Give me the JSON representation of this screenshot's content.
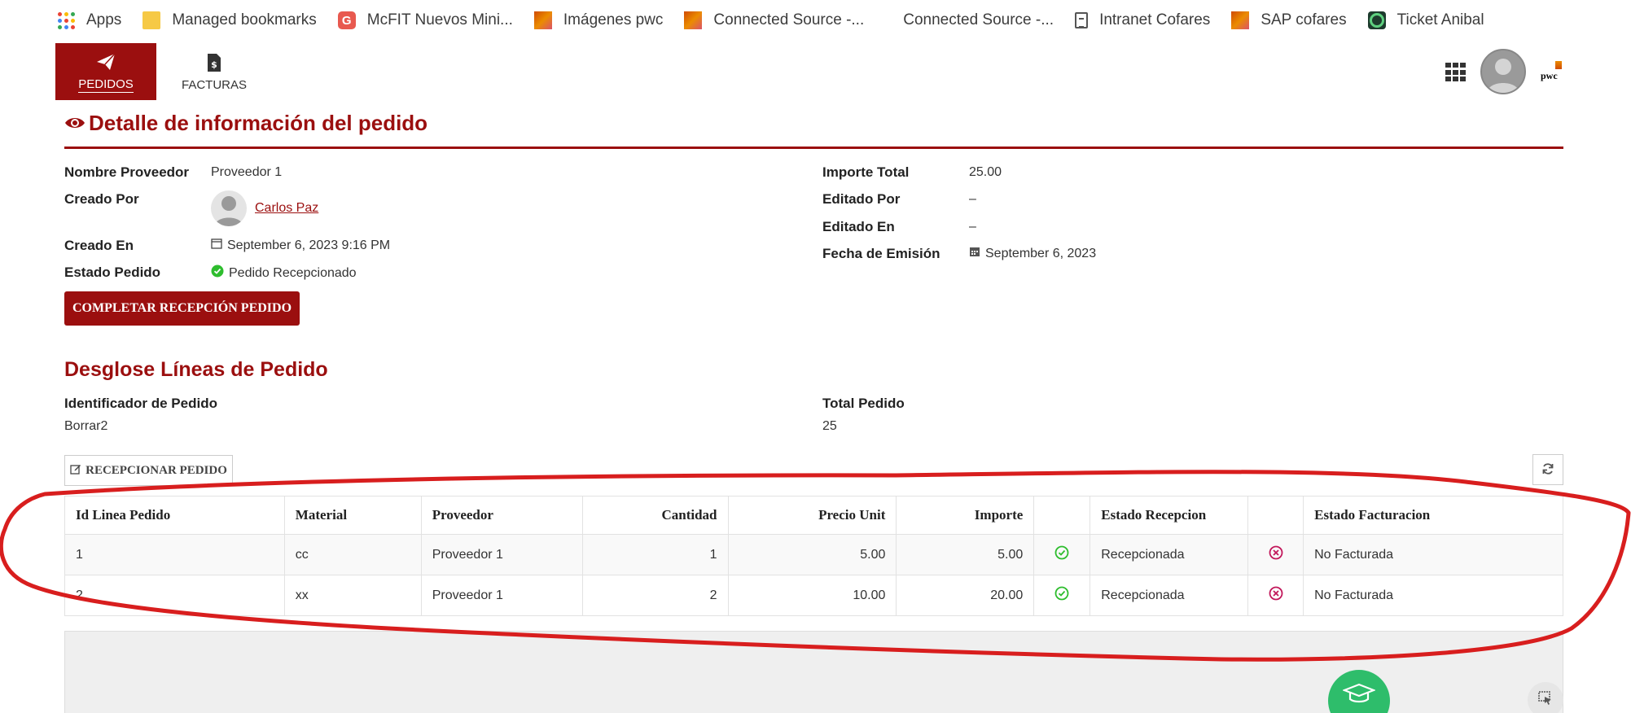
{
  "bookmarks": [
    {
      "label": "Apps",
      "icon": "apps-icon"
    },
    {
      "label": "Managed bookmarks",
      "icon": "folder-icon"
    },
    {
      "label": "McFIT Nuevos Mini...",
      "icon": "g-icon"
    },
    {
      "label": "Imágenes pwc",
      "icon": "pwc-icon"
    },
    {
      "label": "Connected Source -...",
      "icon": "pwc-icon"
    },
    {
      "label": "Connected Source -...",
      "icon": "none"
    },
    {
      "label": "Intranet Cofares",
      "icon": "document-icon"
    },
    {
      "label": "SAP cofares",
      "icon": "pwc-icon"
    },
    {
      "label": "Ticket Anibal",
      "icon": "ring-icon"
    }
  ],
  "nav": {
    "pedidos": "PEDIDOS",
    "facturas": "FACTURAS"
  },
  "page_title": "Detalle de información del pedido",
  "details": {
    "proveedor_label": "Nombre Proveedor",
    "proveedor_value": "Proveedor 1",
    "creado_por_label": "Creado Por",
    "creado_por_value": "Carlos Paz",
    "creado_en_label": "Creado En",
    "creado_en_value": "September 6, 2023 9:16 PM",
    "estado_label": "Estado Pedido",
    "estado_value": "Pedido Recepcionado",
    "importe_label": "Importe Total",
    "importe_value": "25.00",
    "editado_por_label": "Editado Por",
    "editado_por_value": "–",
    "editado_en_label": "Editado En",
    "editado_en_value": "–",
    "emision_label": "Fecha de Emisión",
    "emision_value": "September 6, 2023"
  },
  "complete_button": "COMPLETAR RECEPCIÓN PEDIDO",
  "section": {
    "title": "Desglose Líneas de Pedido",
    "id_label": "Identificador de Pedido",
    "id_value": "Borrar2",
    "total_label": "Total Pedido",
    "total_value": "25"
  },
  "recep_button": "RECEPCIONAR PEDIDO",
  "table": {
    "headers": [
      "Id Linea Pedido",
      "Material",
      "Proveedor",
      "Cantidad",
      "Precio Unit",
      "Importe",
      "",
      "Estado Recepcion",
      "",
      "Estado Facturacion"
    ],
    "rows": [
      {
        "id": "1",
        "material": "cc",
        "proveedor": "Proveedor 1",
        "cantidad": "1",
        "precio": "5.00",
        "importe": "5.00",
        "recep": "Recepcionada",
        "fact": "No Facturada"
      },
      {
        "id": "2",
        "material": "xx",
        "proveedor": "Proveedor 1",
        "cantidad": "2",
        "precio": "10.00",
        "importe": "20.00",
        "recep": "Recepcionada",
        "fact": "No Facturada"
      }
    ]
  },
  "colors": {
    "brand": "#9b0f0f",
    "success": "#2ebd2e",
    "danger": "#c2185b",
    "annotation": "#d81e1e"
  }
}
